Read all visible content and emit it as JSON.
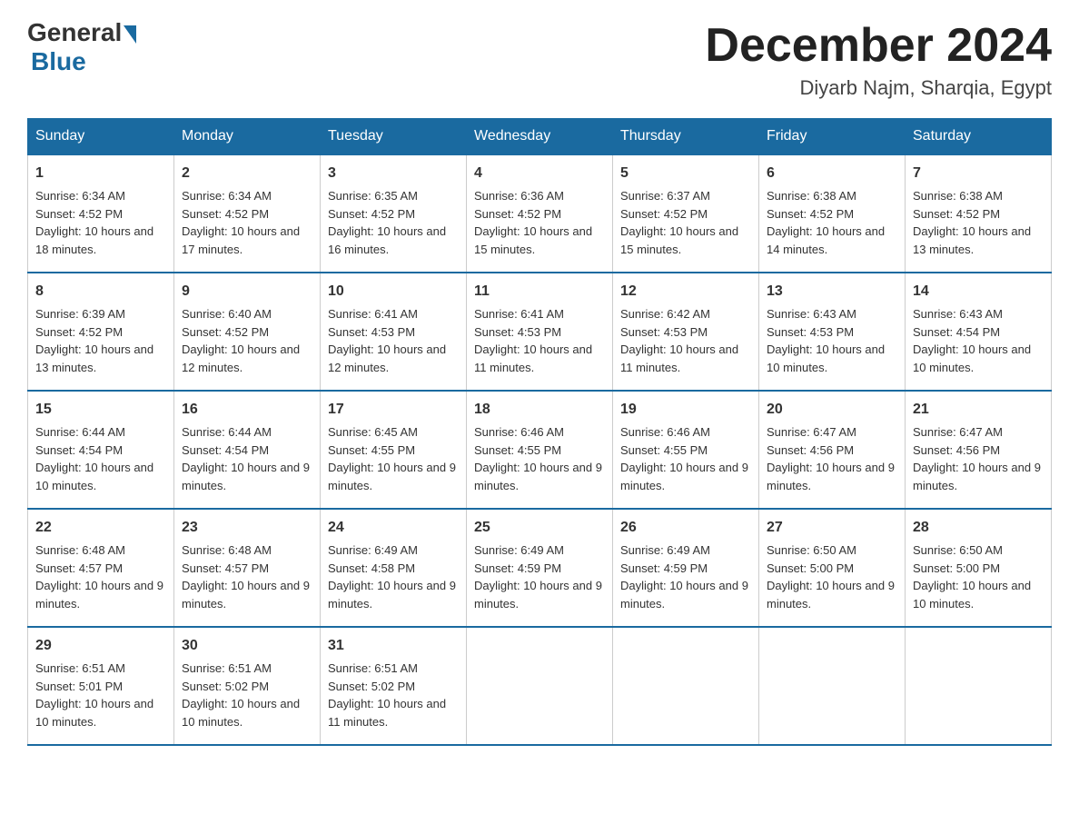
{
  "logo": {
    "general": "General",
    "blue": "Blue"
  },
  "title": "December 2024",
  "location": "Diyarb Najm, Sharqia, Egypt",
  "days_of_week": [
    "Sunday",
    "Monday",
    "Tuesday",
    "Wednesday",
    "Thursday",
    "Friday",
    "Saturday"
  ],
  "weeks": [
    [
      {
        "day": "1",
        "sunrise": "6:34 AM",
        "sunset": "4:52 PM",
        "daylight": "10 hours and 18 minutes."
      },
      {
        "day": "2",
        "sunrise": "6:34 AM",
        "sunset": "4:52 PM",
        "daylight": "10 hours and 17 minutes."
      },
      {
        "day": "3",
        "sunrise": "6:35 AM",
        "sunset": "4:52 PM",
        "daylight": "10 hours and 16 minutes."
      },
      {
        "day": "4",
        "sunrise": "6:36 AM",
        "sunset": "4:52 PM",
        "daylight": "10 hours and 15 minutes."
      },
      {
        "day": "5",
        "sunrise": "6:37 AM",
        "sunset": "4:52 PM",
        "daylight": "10 hours and 15 minutes."
      },
      {
        "day": "6",
        "sunrise": "6:38 AM",
        "sunset": "4:52 PM",
        "daylight": "10 hours and 14 minutes."
      },
      {
        "day": "7",
        "sunrise": "6:38 AM",
        "sunset": "4:52 PM",
        "daylight": "10 hours and 13 minutes."
      }
    ],
    [
      {
        "day": "8",
        "sunrise": "6:39 AM",
        "sunset": "4:52 PM",
        "daylight": "10 hours and 13 minutes."
      },
      {
        "day": "9",
        "sunrise": "6:40 AM",
        "sunset": "4:52 PM",
        "daylight": "10 hours and 12 minutes."
      },
      {
        "day": "10",
        "sunrise": "6:41 AM",
        "sunset": "4:53 PM",
        "daylight": "10 hours and 12 minutes."
      },
      {
        "day": "11",
        "sunrise": "6:41 AM",
        "sunset": "4:53 PM",
        "daylight": "10 hours and 11 minutes."
      },
      {
        "day": "12",
        "sunrise": "6:42 AM",
        "sunset": "4:53 PM",
        "daylight": "10 hours and 11 minutes."
      },
      {
        "day": "13",
        "sunrise": "6:43 AM",
        "sunset": "4:53 PM",
        "daylight": "10 hours and 10 minutes."
      },
      {
        "day": "14",
        "sunrise": "6:43 AM",
        "sunset": "4:54 PM",
        "daylight": "10 hours and 10 minutes."
      }
    ],
    [
      {
        "day": "15",
        "sunrise": "6:44 AM",
        "sunset": "4:54 PM",
        "daylight": "10 hours and 10 minutes."
      },
      {
        "day": "16",
        "sunrise": "6:44 AM",
        "sunset": "4:54 PM",
        "daylight": "10 hours and 9 minutes."
      },
      {
        "day": "17",
        "sunrise": "6:45 AM",
        "sunset": "4:55 PM",
        "daylight": "10 hours and 9 minutes."
      },
      {
        "day": "18",
        "sunrise": "6:46 AM",
        "sunset": "4:55 PM",
        "daylight": "10 hours and 9 minutes."
      },
      {
        "day": "19",
        "sunrise": "6:46 AM",
        "sunset": "4:55 PM",
        "daylight": "10 hours and 9 minutes."
      },
      {
        "day": "20",
        "sunrise": "6:47 AM",
        "sunset": "4:56 PM",
        "daylight": "10 hours and 9 minutes."
      },
      {
        "day": "21",
        "sunrise": "6:47 AM",
        "sunset": "4:56 PM",
        "daylight": "10 hours and 9 minutes."
      }
    ],
    [
      {
        "day": "22",
        "sunrise": "6:48 AM",
        "sunset": "4:57 PM",
        "daylight": "10 hours and 9 minutes."
      },
      {
        "day": "23",
        "sunrise": "6:48 AM",
        "sunset": "4:57 PM",
        "daylight": "10 hours and 9 minutes."
      },
      {
        "day": "24",
        "sunrise": "6:49 AM",
        "sunset": "4:58 PM",
        "daylight": "10 hours and 9 minutes."
      },
      {
        "day": "25",
        "sunrise": "6:49 AM",
        "sunset": "4:59 PM",
        "daylight": "10 hours and 9 minutes."
      },
      {
        "day": "26",
        "sunrise": "6:49 AM",
        "sunset": "4:59 PM",
        "daylight": "10 hours and 9 minutes."
      },
      {
        "day": "27",
        "sunrise": "6:50 AM",
        "sunset": "5:00 PM",
        "daylight": "10 hours and 9 minutes."
      },
      {
        "day": "28",
        "sunrise": "6:50 AM",
        "sunset": "5:00 PM",
        "daylight": "10 hours and 10 minutes."
      }
    ],
    [
      {
        "day": "29",
        "sunrise": "6:51 AM",
        "sunset": "5:01 PM",
        "daylight": "10 hours and 10 minutes."
      },
      {
        "day": "30",
        "sunrise": "6:51 AM",
        "sunset": "5:02 PM",
        "daylight": "10 hours and 10 minutes."
      },
      {
        "day": "31",
        "sunrise": "6:51 AM",
        "sunset": "5:02 PM",
        "daylight": "10 hours and 11 minutes."
      },
      null,
      null,
      null,
      null
    ]
  ]
}
